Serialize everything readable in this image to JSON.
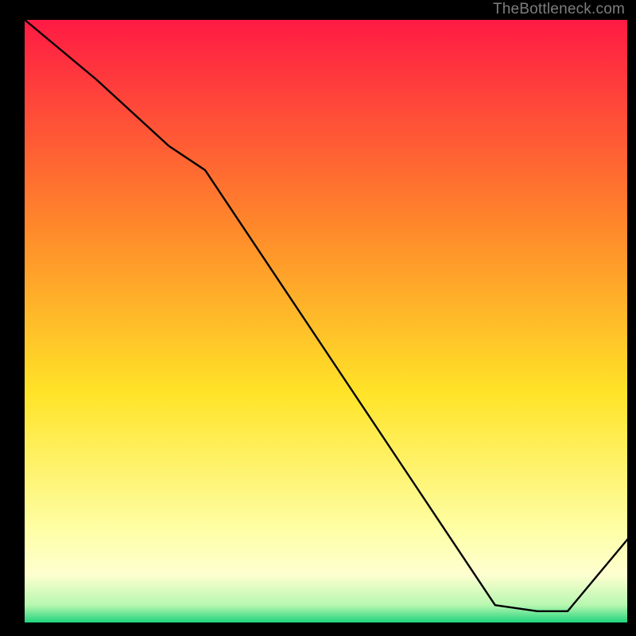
{
  "watermark": "TheBottleneck.com",
  "annotation_label": "",
  "colors": {
    "grad_top": "#ff1a44",
    "grad_mid_orange": "#ff8a2a",
    "grad_yellow": "#ffe428",
    "grad_pale": "#feffc2",
    "grad_green": "#19d27a",
    "line": "#000000",
    "frame": "#000000"
  },
  "chart_data": {
    "type": "line",
    "title": "",
    "xlabel": "",
    "ylabel": "",
    "xlim": [
      0,
      100
    ],
    "ylim": [
      0,
      100
    ],
    "grid": false,
    "legend": false,
    "series": [
      {
        "name": "curve",
        "x": [
          0,
          12,
          24,
          30,
          78,
          85,
          90,
          100
        ],
        "y": [
          100,
          90,
          79,
          75,
          3,
          2,
          2,
          14
        ]
      }
    ],
    "annotations": [
      {
        "x": 84,
        "y": 4,
        "text": ""
      }
    ],
    "background_gradient_stops": [
      {
        "pct": 0,
        "color": "#ff1a44"
      },
      {
        "pct": 35,
        "color": "#ff8a2a"
      },
      {
        "pct": 62,
        "color": "#ffe428"
      },
      {
        "pct": 85,
        "color": "#feffa8"
      },
      {
        "pct": 92,
        "color": "#feffd0"
      },
      {
        "pct": 97,
        "color": "#b7f7b0"
      },
      {
        "pct": 100,
        "color": "#19d27a"
      }
    ]
  }
}
